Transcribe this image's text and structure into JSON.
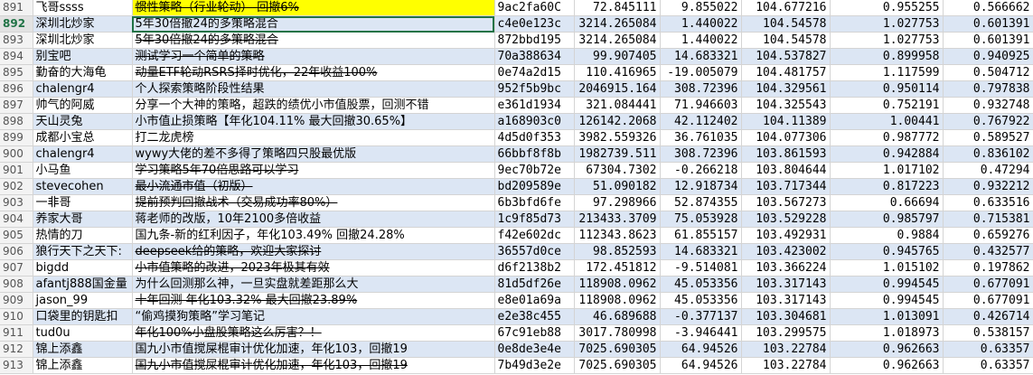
{
  "rows": [
    {
      "num": "891",
      "user": "飞哥ssss",
      "title": "惯性策略（行业轮动）-回撤6%",
      "id": "9ac2fa60C",
      "v1": "72.845111",
      "v2": "9.855022",
      "v3": "104.677216",
      "v4": "0.955255",
      "v5": "0.566662",
      "strike": true,
      "hl": true,
      "alt": false
    },
    {
      "num": "892",
      "user": "深圳北炒家",
      "title": "5年30倍撤24的多策略混合",
      "id": "c4e0e123c",
      "v1": "3214.265084",
      "v2": "1.440022",
      "v3": "104.54578",
      "v4": "1.027753",
      "v5": "0.601391",
      "strike": false,
      "hl": false,
      "alt": true,
      "active": true
    },
    {
      "num": "893",
      "user": "深圳北炒家",
      "title": "5年30倍撤24的多策略混合",
      "id": "872bbd195",
      "v1": "3214.265084",
      "v2": "1.440022",
      "v3": "104.54578",
      "v4": "1.027753",
      "v5": "0.601391",
      "strike": true,
      "hl": false,
      "alt": false
    },
    {
      "num": "894",
      "user": "别宝吧",
      "title": "测试学习一个简单的策略",
      "id": "70a388634",
      "v1": "99.907405",
      "v2": "14.683321",
      "v3": "104.537827",
      "v4": "0.899958",
      "v5": "0.940925",
      "strike": true,
      "hl": false,
      "alt": true
    },
    {
      "num": "895",
      "user": "勤奋的大海龟",
      "title": "动量ETF轮动RSRS择时优化，22年收益100%",
      "id": "0e74a2d15",
      "v1": "110.416965",
      "v2": "-19.005079",
      "v3": "104.481757",
      "v4": "1.117599",
      "v5": "0.504712",
      "strike": true,
      "hl": false,
      "alt": false
    },
    {
      "num": "896",
      "user": "chalengr4",
      "title": "个人探索策略阶段性结果",
      "id": "952f5b9bc",
      "v1": "2046915.164",
      "v2": "308.72396",
      "v3": "104.329561",
      "v4": "0.950114",
      "v5": "0.797838",
      "strike": false,
      "hl": false,
      "alt": true
    },
    {
      "num": "897",
      "user": "帅气的阿威",
      "title": "分享一个大神的策略，超跌的绩优小市值股票，回测不错",
      "id": "e361d1934",
      "v1": "321.084441",
      "v2": "71.946603",
      "v3": "104.325543",
      "v4": "0.752191",
      "v5": "0.932748",
      "strike": false,
      "hl": false,
      "alt": false
    },
    {
      "num": "898",
      "user": "天山灵兔",
      "title": "小市值止损策略【年化104.11% 最大回撤30.65%】",
      "id": "a168903c0",
      "v1": "126142.2068",
      "v2": "42.112402",
      "v3": "104.11389",
      "v4": "1.00441",
      "v5": "0.767922",
      "strike": false,
      "hl": false,
      "alt": true
    },
    {
      "num": "899",
      "user": "成都小宝总",
      "title": "打二龙虎榜",
      "id": "4d5d0f353",
      "v1": "3982.559326",
      "v2": "36.761035",
      "v3": "104.077306",
      "v4": "0.987772",
      "v5": "0.589527",
      "strike": false,
      "hl": false,
      "alt": false
    },
    {
      "num": "900",
      "user": "chalengr4",
      "title": "wywy大佬的差不多得了策略四只股最优版",
      "id": "66bbf8f8b",
      "v1": "1982739.511",
      "v2": "308.72396",
      "v3": "103.861593",
      "v4": "0.942884",
      "v5": "0.836102",
      "strike": false,
      "hl": false,
      "alt": true
    },
    {
      "num": "901",
      "user": "小马鱼",
      "title": "学习策略5年70倍思路可以学习",
      "id": "9ec70b72e",
      "v1": "67304.7302",
      "v2": "-0.266218",
      "v3": "103.804644",
      "v4": "1.017102",
      "v5": "0.47294",
      "strike": true,
      "hl": false,
      "alt": false
    },
    {
      "num": "902",
      "user": "stevecohen",
      "title": "最小流通市值（初版）",
      "id": "bd209589e",
      "v1": "51.090182",
      "v2": "12.918734",
      "v3": "103.717344",
      "v4": "0.817223",
      "v5": "0.932212",
      "strike": true,
      "hl": false,
      "alt": true
    },
    {
      "num": "903",
      "user": "一非哥",
      "title": "提前预判回撤战术（交易成功率80%）",
      "id": "6b3bfd6fe",
      "v1": "97.298966",
      "v2": "52.874355",
      "v3": "103.567273",
      "v4": "0.66694",
      "v5": "0.633516",
      "strike": true,
      "hl": false,
      "alt": false
    },
    {
      "num": "904",
      "user": "养家大哥",
      "title": "蒋老师的改版，10年2100多倍收益",
      "id": "1c9f85d73",
      "v1": "213433.3709",
      "v2": "75.053928",
      "v3": "103.529228",
      "v4": "0.985797",
      "v5": "0.715381",
      "strike": false,
      "hl": false,
      "alt": true
    },
    {
      "num": "905",
      "user": "热情的刀",
      "title": "国九条-新的红利因子，年化103.49% 回撤24.28%",
      "id": "f42e602dc",
      "v1": "112343.8623",
      "v2": "61.855157",
      "v3": "103.492931",
      "v4": "0.9884",
      "v5": "0.659276",
      "strike": false,
      "hl": false,
      "alt": false
    },
    {
      "num": "906",
      "user": "狼行天下之天下:",
      "title": "deepseek给的策略，欢迎大家探讨",
      "id": "36557d0ce",
      "v1": "98.852593",
      "v2": "14.683321",
      "v3": "103.423002",
      "v4": "0.945765",
      "v5": "0.432577",
      "strike": true,
      "hl": false,
      "alt": true
    },
    {
      "num": "907",
      "user": "bigdd",
      "title": "小市值策略的改进，2023年极其有效",
      "id": "d6f2138b2",
      "v1": "172.451812",
      "v2": "-9.514081",
      "v3": "103.366224",
      "v4": "1.015102",
      "v5": "0.197862",
      "strike": true,
      "hl": false,
      "alt": false
    },
    {
      "num": "908",
      "user": "afantj888国金量",
      "title": "为什么回测那么神，一旦实盘就差距那么大",
      "id": "81d5df26e",
      "v1": "118908.0962",
      "v2": "45.053356",
      "v3": "103.317143",
      "v4": "0.994545",
      "v5": "0.677091",
      "strike": false,
      "hl": false,
      "alt": true
    },
    {
      "num": "909",
      "user": "jason_99",
      "title": "十年回测 年化103.32% 最大回撤23.89%",
      "id": "e8e01a69a",
      "v1": "118908.0962",
      "v2": "45.053356",
      "v3": "103.317143",
      "v4": "0.994545",
      "v5": "0.677091",
      "strike": true,
      "hl": false,
      "alt": false
    },
    {
      "num": "910",
      "user": "口袋里的钥匙扣",
      "title": "“偷鸡摸狗策略”学习笔记",
      "id": "e2e38c455",
      "v1": "46.689688",
      "v2": "-0.377137",
      "v3": "103.304681",
      "v4": "1.013091",
      "v5": "0.426714",
      "strike": false,
      "hl": false,
      "alt": true
    },
    {
      "num": "911",
      "user": "tud0u",
      "title": "年化100%小盘股策略这么厉害？！",
      "id": "67c91eb88",
      "v1": "3017.780998",
      "v2": "-3.946441",
      "v3": "103.299575",
      "v4": "1.018973",
      "v5": "0.538157",
      "strike": true,
      "hl": false,
      "alt": false
    },
    {
      "num": "912",
      "user": "锦上添鑫",
      "title": "国九小市值搅屎棍审计优化加速，年化103，回撤19",
      "id": "0e8de3e4e",
      "v1": "7025.690305",
      "v2": "64.94526",
      "v3": "103.22784",
      "v4": "0.962663",
      "v5": "0.63357",
      "strike": false,
      "hl": false,
      "alt": true
    },
    {
      "num": "913",
      "user": "锦上添鑫",
      "title": "国九小市值搅屎棍审计优化加速，年化103，回撤19",
      "id": "7b49d3e2e",
      "v1": "7025.690305",
      "v2": "64.94526",
      "v3": "103.22784",
      "v4": "0.962663",
      "v5": "0.63357",
      "strike": true,
      "hl": false,
      "alt": false
    }
  ]
}
